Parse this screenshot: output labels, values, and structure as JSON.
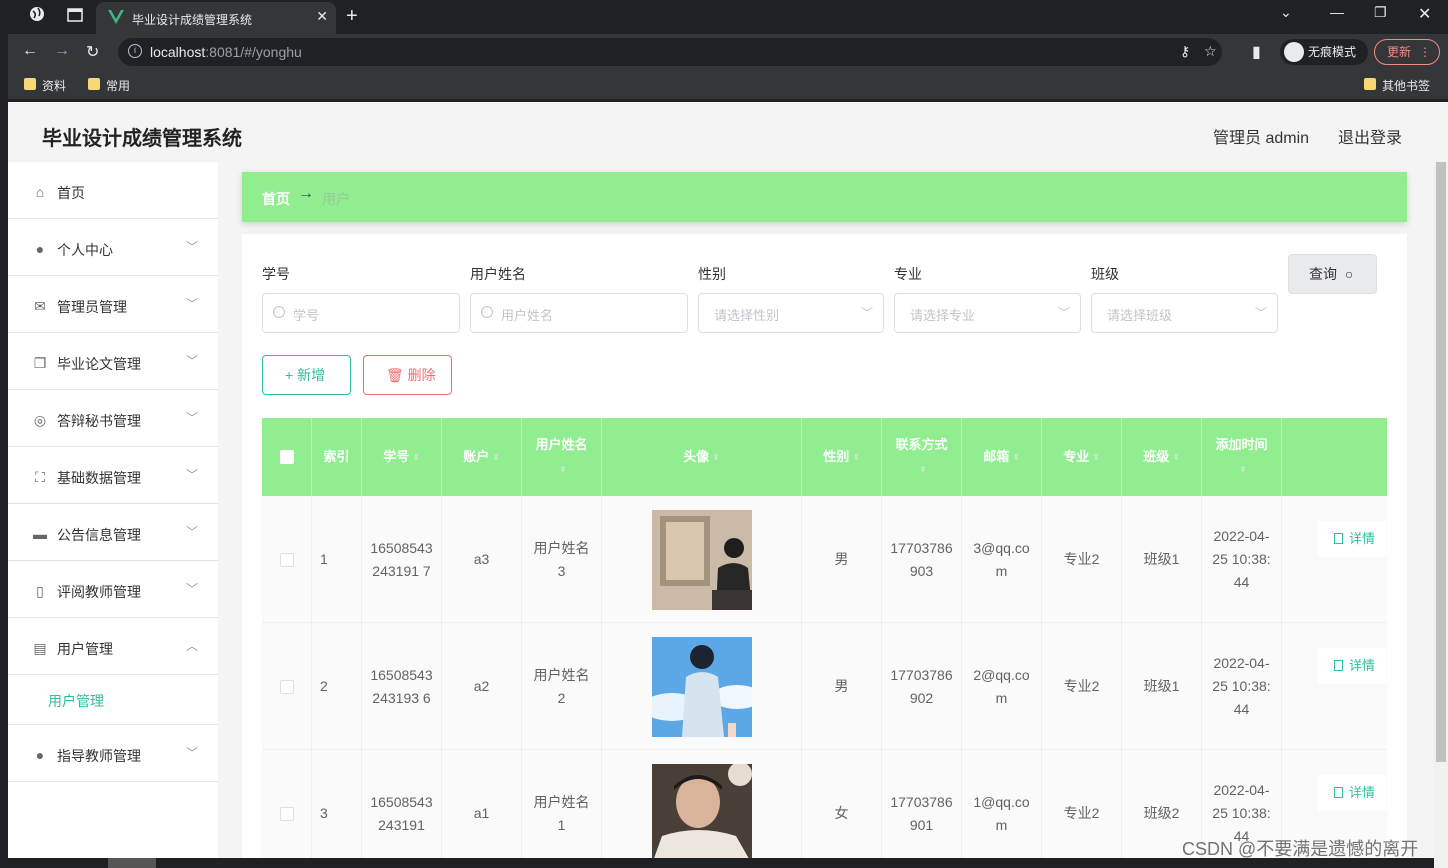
{
  "browser": {
    "tab_title": "毕业设计成绩管理系统",
    "url_host": "localhost",
    "url_rest": ":8081/#/yonghu",
    "incognito_label": "无痕模式",
    "update_label": "更新",
    "bookmarks": [
      "资料",
      "常用"
    ],
    "other_bookmarks": "其他书签"
  },
  "header": {
    "app_title": "毕业设计成绩管理系统",
    "admin_label": "管理员 admin",
    "logout_label": "退出登录"
  },
  "sidebar": {
    "items": [
      {
        "label": "首页",
        "icon": "home-icon"
      },
      {
        "label": "个人中心",
        "icon": "user-icon"
      },
      {
        "label": "管理员管理",
        "icon": "mail-icon"
      },
      {
        "label": "毕业论文管理",
        "icon": "copy-icon"
      },
      {
        "label": "答辩秘书管理",
        "icon": "target-icon"
      },
      {
        "label": "基础数据管理",
        "icon": "fullscreen-icon"
      },
      {
        "label": "公告信息管理",
        "icon": "monitor-icon"
      },
      {
        "label": "评阅教师管理",
        "icon": "microphone-icon"
      },
      {
        "label": "用户管理",
        "icon": "clipboard-icon"
      },
      {
        "label": "指导教师管理",
        "icon": "bulb-icon"
      }
    ],
    "submenu_label": "用户管理"
  },
  "breadcrumb": {
    "home": "首页",
    "arrow": "→",
    "current": "用户"
  },
  "filters": {
    "student_id_label": "学号",
    "student_id_placeholder": "学号",
    "name_label": "用户姓名",
    "name_placeholder": "用户姓名",
    "gender_label": "性别",
    "gender_placeholder": "请选择性别",
    "major_label": "专业",
    "major_placeholder": "请选择专业",
    "class_label": "班级",
    "class_placeholder": "请选择班级",
    "query_button": "查询"
  },
  "actions": {
    "add_button": "新增",
    "delete_button": "删除"
  },
  "table": {
    "headers": [
      "索引",
      "学号",
      "账户",
      "用户姓名",
      "头像",
      "性别",
      "联系方式",
      "邮箱",
      "专业",
      "班级",
      "添加时间"
    ],
    "detail_label": "详情",
    "rows": [
      {
        "index": "1",
        "student_id": "16508543243191 7",
        "account": "a3",
        "name": "用户姓名3",
        "gender": "男",
        "phone": "17703786903",
        "email": "3@qq.com",
        "major": "专业2",
        "class": "班级1",
        "time": "2022-04-25 10:38:44"
      },
      {
        "index": "2",
        "student_id": "16508543243193 6",
        "account": "a2",
        "name": "用户姓名2",
        "gender": "男",
        "phone": "17703786902",
        "email": "2@qq.com",
        "major": "专业2",
        "class": "班级1",
        "time": "2022-04-25 10:38:44"
      },
      {
        "index": "3",
        "student_id": "16508543243191",
        "account": "a1",
        "name": "用户姓名1",
        "gender": "女",
        "phone": "17703786901",
        "email": "1@qq.com",
        "major": "专业2",
        "class": "班级2",
        "time": "2022-04-25 10:38:44"
      }
    ]
  },
  "watermark": "CSDN @不要满是遗憾的离开",
  "colors": {
    "accent": "#2bbf9e",
    "header_green": "#90ee90",
    "danger": "#f56c6c"
  }
}
